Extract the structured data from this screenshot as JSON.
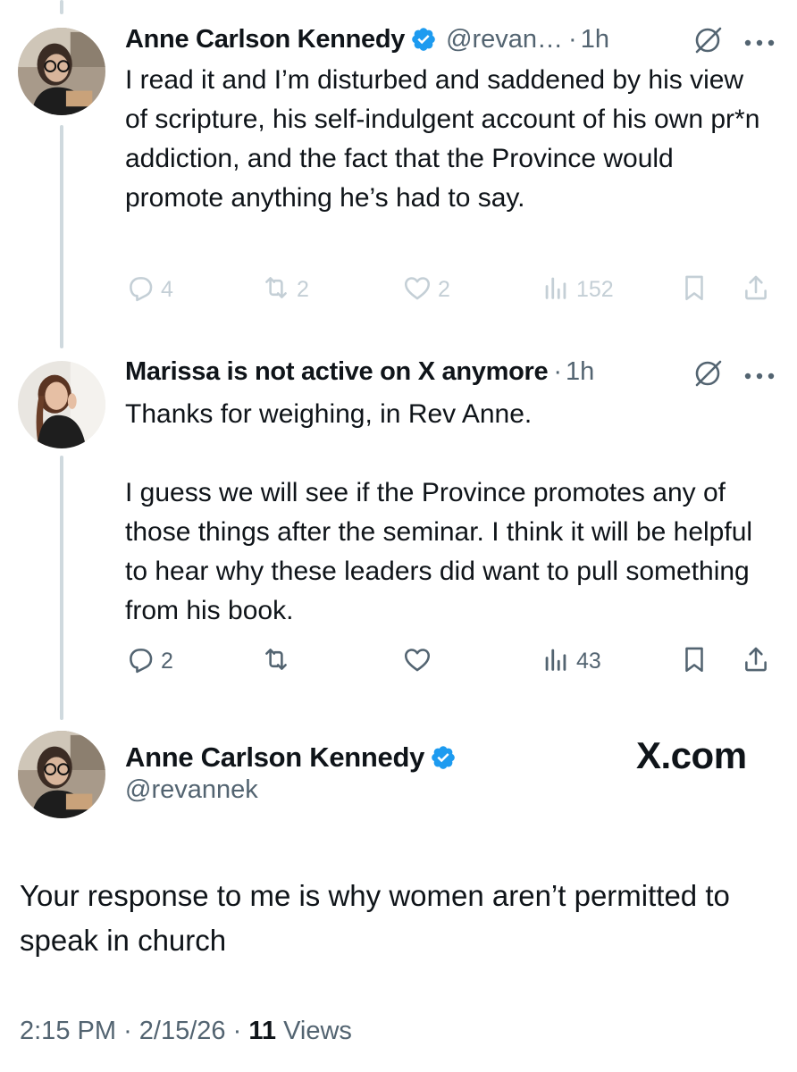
{
  "colors": {
    "accent": "#1d9bf0",
    "text": "#0f1419",
    "muted": "#536471",
    "faded": "#c4cfd6",
    "thread_line": "#cfd9de"
  },
  "replies": [
    {
      "name": "Anne Carlson Kennedy",
      "verified": true,
      "handle": "@revan…",
      "sep": "·",
      "time": "1h",
      "paragraphs": [
        "I read it and I’m disturbed and saddened by his view of scripture, his self-indulgent account of his own pr*n addiction, and the fact that the Province would promote anything he’s had to say."
      ],
      "actions": {
        "reply_count": "4",
        "repost_count": "2",
        "like_count": "2",
        "views_count": "152"
      }
    },
    {
      "name": "Marissa is not active on X anymore",
      "verified": false,
      "sep": "·",
      "time": "1h",
      "paragraphs": [
        "Thanks for weighing, in Rev Anne.",
        "I guess we will see if the Province promotes any of those things after the seminar. I think it will be helpful to hear why these leaders did want to pull something from his book."
      ],
      "actions": {
        "reply_count": "2",
        "repost_count": "",
        "like_count": "",
        "views_count": "43"
      }
    }
  ],
  "main_tweet": {
    "name": "Anne Carlson Kennedy",
    "verified": true,
    "handle": "@revannek",
    "watermark": "X.com",
    "text": "Your response to me is why women aren’t permitted to speak in church",
    "time": "2:15 PM",
    "sep1": "·",
    "date": "2/15/26",
    "sep2": "·",
    "views_count": "11",
    "views_label": "Views"
  },
  "icons": [
    "verified-badge-icon",
    "grok-icon",
    "more-icon",
    "reply-icon",
    "repost-icon",
    "like-icon",
    "views-icon",
    "bookmark-icon",
    "share-icon"
  ]
}
